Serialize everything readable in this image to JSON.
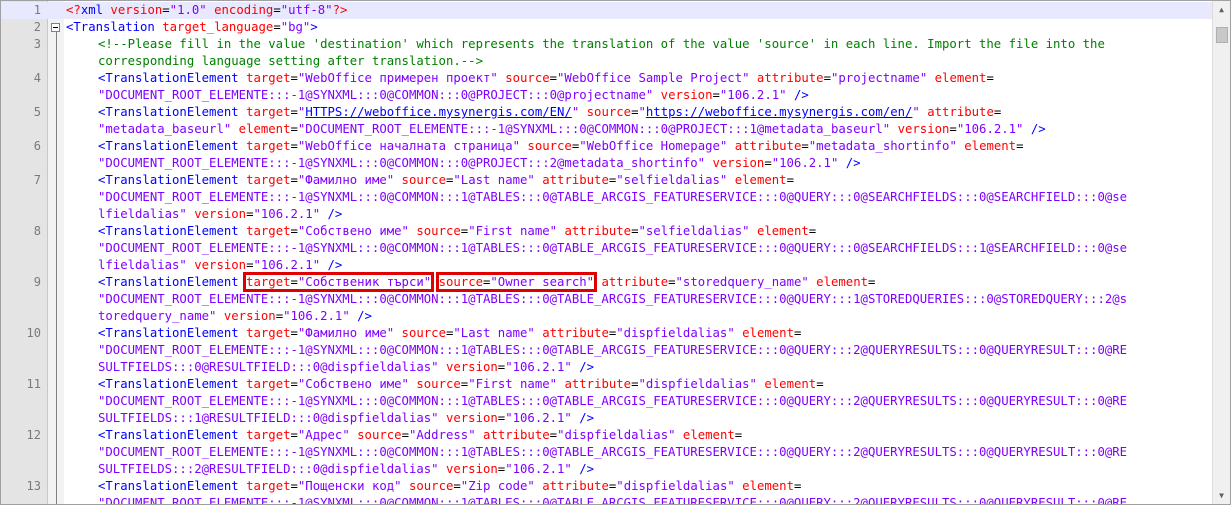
{
  "editor": {
    "current_line": 1,
    "scroll_position": 0.02
  },
  "scrollbar": {
    "up_arrow": "▲",
    "down_arrow": "▼"
  },
  "lines": [
    {
      "n": "1",
      "rows": [
        [
          [
            "pi",
            "<?"
          ],
          [
            "tag",
            "xml"
          ],
          [
            "att",
            " version"
          ],
          [
            "op",
            "="
          ],
          [
            "val",
            "\"1.0\""
          ],
          [
            "att",
            " encoding"
          ],
          [
            "op",
            "="
          ],
          [
            "val",
            "\"utf-8\""
          ],
          [
            "pi",
            "?>"
          ]
        ]
      ]
    },
    {
      "n": "2",
      "rows": [
        [
          [
            "tag",
            "<Translation"
          ],
          [
            "att",
            " target_language"
          ],
          [
            "op",
            "="
          ],
          [
            "val",
            "\"bg\""
          ],
          [
            "tag",
            ">"
          ]
        ]
      ]
    },
    {
      "n": "3",
      "rows": [
        [
          [
            "cmt",
            "<!--Please fill in the value 'destination' which represents the translation of the value 'source' in each line. Import the file into the"
          ]
        ],
        [
          [
            "cmt",
            "corresponding language setting after translation.-->"
          ]
        ]
      ]
    },
    {
      "n": "4",
      "rows": [
        [
          [
            "tag",
            "<TranslationElement"
          ],
          [
            "att",
            " target"
          ],
          [
            "op",
            "="
          ],
          [
            "val",
            "\"WebOffice примерен проект\""
          ],
          [
            "att",
            " source"
          ],
          [
            "op",
            "="
          ],
          [
            "val",
            "\"WebOffice Sample Project\""
          ],
          [
            "att",
            " attribute"
          ],
          [
            "op",
            "="
          ],
          [
            "val",
            "\"projectname\""
          ],
          [
            "att",
            " element"
          ],
          [
            "op",
            "="
          ]
        ],
        [
          [
            "val",
            "\"DOCUMENT_ROOT_ELEMENTE:::-1@SYNXML:::0@COMMON:::0@PROJECT:::0@projectname\""
          ],
          [
            "att",
            " version"
          ],
          [
            "op",
            "="
          ],
          [
            "val",
            "\"106.2.1\""
          ],
          [
            "tag",
            " />"
          ]
        ]
      ]
    },
    {
      "n": "5",
      "rows": [
        [
          [
            "tag",
            "<TranslationElement"
          ],
          [
            "att",
            " target"
          ],
          [
            "op",
            "="
          ],
          [
            "val",
            "\""
          ],
          [
            "lnk",
            "HTTPS://weboffice.mysynergis.com/EN/"
          ],
          [
            "val",
            "\""
          ],
          [
            "att",
            " source"
          ],
          [
            "op",
            "="
          ],
          [
            "val",
            "\""
          ],
          [
            "lnk",
            "https://weboffice.mysynergis.com/en/"
          ],
          [
            "val",
            "\""
          ],
          [
            "att",
            " attribute"
          ],
          [
            "op",
            "="
          ]
        ],
        [
          [
            "val",
            "\"metadata_baseurl\""
          ],
          [
            "att",
            " element"
          ],
          [
            "op",
            "="
          ],
          [
            "val",
            "\"DOCUMENT_ROOT_ELEMENTE:::-1@SYNXML:::0@COMMON:::0@PROJECT:::1@metadata_baseurl\""
          ],
          [
            "att",
            " version"
          ],
          [
            "op",
            "="
          ],
          [
            "val",
            "\"106.2.1\""
          ],
          [
            "tag",
            " />"
          ]
        ]
      ]
    },
    {
      "n": "6",
      "rows": [
        [
          [
            "tag",
            "<TranslationElement"
          ],
          [
            "att",
            " target"
          ],
          [
            "op",
            "="
          ],
          [
            "val",
            "\"WebOffice началната страница\""
          ],
          [
            "att",
            " source"
          ],
          [
            "op",
            "="
          ],
          [
            "val",
            "\"WebOffice Homepage\""
          ],
          [
            "att",
            " attribute"
          ],
          [
            "op",
            "="
          ],
          [
            "val",
            "\"metadata_shortinfo\""
          ],
          [
            "att",
            " element"
          ],
          [
            "op",
            "="
          ]
        ],
        [
          [
            "val",
            "\"DOCUMENT_ROOT_ELEMENTE:::-1@SYNXML:::0@COMMON:::0@PROJECT:::2@metadata_shortinfo\""
          ],
          [
            "att",
            " version"
          ],
          [
            "op",
            "="
          ],
          [
            "val",
            "\"106.2.1\""
          ],
          [
            "tag",
            " />"
          ]
        ]
      ]
    },
    {
      "n": "7",
      "rows": [
        [
          [
            "tag",
            "<TranslationElement"
          ],
          [
            "att",
            " target"
          ],
          [
            "op",
            "="
          ],
          [
            "val",
            "\"Фамилно име\""
          ],
          [
            "att",
            " source"
          ],
          [
            "op",
            "="
          ],
          [
            "val",
            "\"Last name\""
          ],
          [
            "att",
            " attribute"
          ],
          [
            "op",
            "="
          ],
          [
            "val",
            "\"selfieldalias\""
          ],
          [
            "att",
            " element"
          ],
          [
            "op",
            "="
          ]
        ],
        [
          [
            "val",
            "\"DOCUMENT_ROOT_ELEMENTE:::-1@SYNXML:::0@COMMON:::1@TABLES:::0@TABLE_ARCGIS_FEATURESERVICE:::0@QUERY:::0@SEARCHFIELDS:::0@SEARCHFIELD:::0@se"
          ]
        ],
        [
          [
            "val",
            "lfieldalias\""
          ],
          [
            "att",
            " version"
          ],
          [
            "op",
            "="
          ],
          [
            "val",
            "\"106.2.1\""
          ],
          [
            "tag",
            " />"
          ]
        ]
      ]
    },
    {
      "n": "8",
      "rows": [
        [
          [
            "tag",
            "<TranslationElement"
          ],
          [
            "att",
            " target"
          ],
          [
            "op",
            "="
          ],
          [
            "val",
            "\"Собствено име\""
          ],
          [
            "att",
            " source"
          ],
          [
            "op",
            "="
          ],
          [
            "val",
            "\"First name\""
          ],
          [
            "att",
            " attribute"
          ],
          [
            "op",
            "="
          ],
          [
            "val",
            "\"selfieldalias\""
          ],
          [
            "att",
            " element"
          ],
          [
            "op",
            "="
          ]
        ],
        [
          [
            "val",
            "\"DOCUMENT_ROOT_ELEMENTE:::-1@SYNXML:::0@COMMON:::1@TABLES:::0@TABLE_ARCGIS_FEATURESERVICE:::0@QUERY:::0@SEARCHFIELDS:::1@SEARCHFIELD:::0@se"
          ]
        ],
        [
          [
            "val",
            "lfieldalias\""
          ],
          [
            "att",
            " version"
          ],
          [
            "op",
            "="
          ],
          [
            "val",
            "\"106.2.1\""
          ],
          [
            "tag",
            " />"
          ]
        ]
      ]
    },
    {
      "n": "9",
      "rows": [
        [
          [
            "tag",
            "<TranslationElement"
          ],
          [
            "op",
            " "
          ],
          [
            "att",
            "target",
            1
          ],
          [
            "op",
            "=",
            1
          ],
          [
            "val",
            "\"Собственик търси\"",
            1
          ],
          [
            "op",
            " "
          ],
          [
            "att",
            "source",
            2
          ],
          [
            "op",
            "=",
            2
          ],
          [
            "val",
            "\"Owner search\"",
            2
          ],
          [
            "att",
            " attribute"
          ],
          [
            "op",
            "="
          ],
          [
            "val",
            "\"storedquery_name\""
          ],
          [
            "att",
            " element"
          ],
          [
            "op",
            "="
          ]
        ],
        [
          [
            "val",
            "\"DOCUMENT_ROOT_ELEMENTE:::-1@SYNXML:::0@COMMON:::1@TABLES:::0@TABLE_ARCGIS_FEATURESERVICE:::0@QUERY:::1@STOREDQUERIES:::0@STOREDQUERY:::2@s"
          ]
        ],
        [
          [
            "val",
            "toredquery_name\""
          ],
          [
            "att",
            " version"
          ],
          [
            "op",
            "="
          ],
          [
            "val",
            "\"106.2.1\""
          ],
          [
            "tag",
            " />"
          ]
        ]
      ]
    },
    {
      "n": "10",
      "rows": [
        [
          [
            "tag",
            "<TranslationElement"
          ],
          [
            "att",
            " target"
          ],
          [
            "op",
            "="
          ],
          [
            "val",
            "\"Фамилно име\""
          ],
          [
            "att",
            " source"
          ],
          [
            "op",
            "="
          ],
          [
            "val",
            "\"Last name\""
          ],
          [
            "att",
            " attribute"
          ],
          [
            "op",
            "="
          ],
          [
            "val",
            "\"dispfieldalias\""
          ],
          [
            "att",
            " element"
          ],
          [
            "op",
            "="
          ]
        ],
        [
          [
            "val",
            "\"DOCUMENT_ROOT_ELEMENTE:::-1@SYNXML:::0@COMMON:::1@TABLES:::0@TABLE_ARCGIS_FEATURESERVICE:::0@QUERY:::2@QUERYRESULTS:::0@QUERYRESULT:::0@RE"
          ]
        ],
        [
          [
            "val",
            "SULTFIELDS:::0@RESULTFIELD:::0@dispfieldalias\""
          ],
          [
            "att",
            " version"
          ],
          [
            "op",
            "="
          ],
          [
            "val",
            "\"106.2.1\""
          ],
          [
            "tag",
            " />"
          ]
        ]
      ]
    },
    {
      "n": "11",
      "rows": [
        [
          [
            "tag",
            "<TranslationElement"
          ],
          [
            "att",
            " target"
          ],
          [
            "op",
            "="
          ],
          [
            "val",
            "\"Собствено име\""
          ],
          [
            "att",
            " source"
          ],
          [
            "op",
            "="
          ],
          [
            "val",
            "\"First name\""
          ],
          [
            "att",
            " attribute"
          ],
          [
            "op",
            "="
          ],
          [
            "val",
            "\"dispfieldalias\""
          ],
          [
            "att",
            " element"
          ],
          [
            "op",
            "="
          ]
        ],
        [
          [
            "val",
            "\"DOCUMENT_ROOT_ELEMENTE:::-1@SYNXML:::0@COMMON:::1@TABLES:::0@TABLE_ARCGIS_FEATURESERVICE:::0@QUERY:::2@QUERYRESULTS:::0@QUERYRESULT:::0@RE"
          ]
        ],
        [
          [
            "val",
            "SULTFIELDS:::1@RESULTFIELD:::0@dispfieldalias\""
          ],
          [
            "att",
            " version"
          ],
          [
            "op",
            "="
          ],
          [
            "val",
            "\"106.2.1\""
          ],
          [
            "tag",
            " />"
          ]
        ]
      ]
    },
    {
      "n": "12",
      "rows": [
        [
          [
            "tag",
            "<TranslationElement"
          ],
          [
            "att",
            " target"
          ],
          [
            "op",
            "="
          ],
          [
            "val",
            "\"Адрес\""
          ],
          [
            "att",
            " source"
          ],
          [
            "op",
            "="
          ],
          [
            "val",
            "\"Address\""
          ],
          [
            "att",
            " attribute"
          ],
          [
            "op",
            "="
          ],
          [
            "val",
            "\"dispfieldalias\""
          ],
          [
            "att",
            " element"
          ],
          [
            "op",
            "="
          ]
        ],
        [
          [
            "val",
            "\"DOCUMENT_ROOT_ELEMENTE:::-1@SYNXML:::0@COMMON:::1@TABLES:::0@TABLE_ARCGIS_FEATURESERVICE:::0@QUERY:::2@QUERYRESULTS:::0@QUERYRESULT:::0@RE"
          ]
        ],
        [
          [
            "val",
            "SULTFIELDS:::2@RESULTFIELD:::0@dispfieldalias\""
          ],
          [
            "att",
            " version"
          ],
          [
            "op",
            "="
          ],
          [
            "val",
            "\"106.2.1\""
          ],
          [
            "tag",
            " />"
          ]
        ]
      ]
    },
    {
      "n": "13",
      "rows": [
        [
          [
            "tag",
            "<TranslationElement"
          ],
          [
            "att",
            " target"
          ],
          [
            "op",
            "="
          ],
          [
            "val",
            "\"Пощенски код\""
          ],
          [
            "att",
            " source"
          ],
          [
            "op",
            "="
          ],
          [
            "val",
            "\"Zip code\""
          ],
          [
            "att",
            " attribute"
          ],
          [
            "op",
            "="
          ],
          [
            "val",
            "\"dispfieldalias\""
          ],
          [
            "att",
            " element"
          ],
          [
            "op",
            "="
          ]
        ],
        [
          [
            "val",
            "\"DOCUMENT_ROOT_ELEMENTE:::-1@SYNXML:::0@COMMON:::1@TABLES:::0@TABLE_ARCGIS_FEATURESERVICE:::0@QUERY:::2@QUERYRESULTS:::0@QUERYRESULT:::0@RE"
          ]
        ]
      ]
    }
  ]
}
